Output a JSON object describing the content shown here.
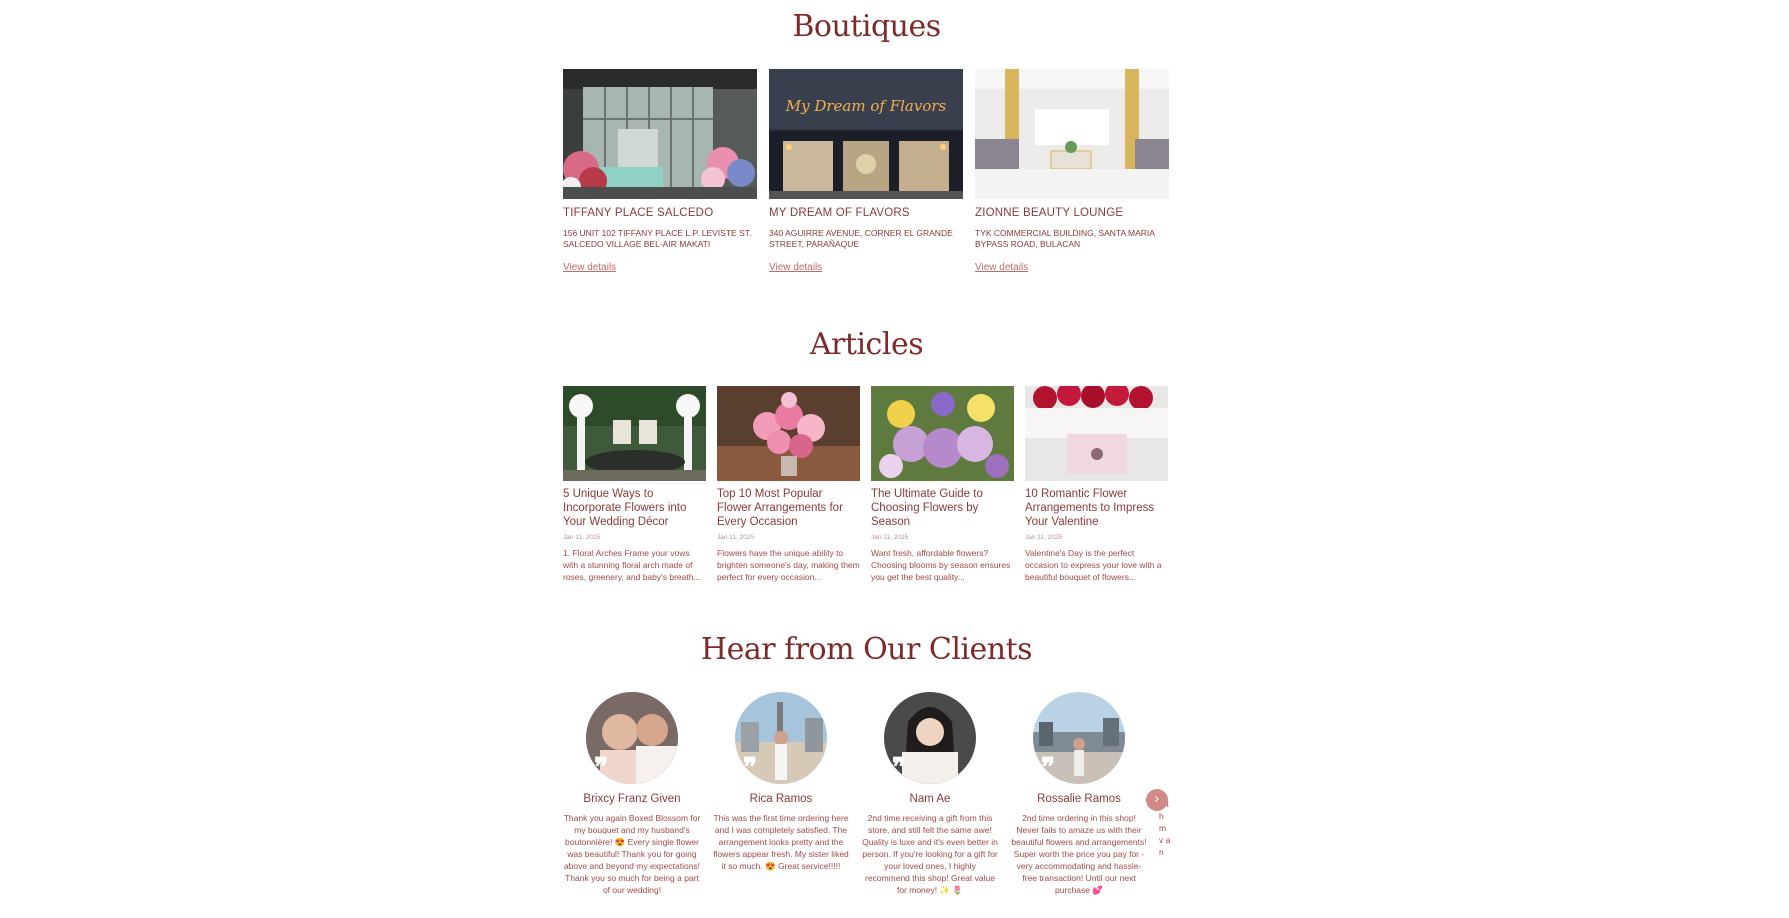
{
  "boutiques": {
    "title": "Boutiques",
    "items": [
      {
        "name": "TIFFANY PLACE SALCEDO",
        "address": "156 UNIT 102 TIFFANY PLACE L.P. LEVISTE ST. SALCEDO VILLAGE BEL-AIR MAKATI",
        "link": "View details"
      },
      {
        "name": "MY DREAM OF FLAVORS",
        "address": "340 AGUIRRE AVENUE, CORNER EL GRANDE STREET, PARAÑAQUE",
        "link": "View details",
        "sign": "My Dream of Flavors"
      },
      {
        "name": "ZIONNE BEAUTY LOUNGE",
        "address": "TYK COMMERCIAL BUILDING, SANTA MARIA BYPASS ROAD, BULACAN",
        "link": "View details"
      }
    ]
  },
  "articles": {
    "title": "Articles",
    "items": [
      {
        "title": "5 Unique Ways to Incorporate Flowers into Your Wedding Décor",
        "date": "Jan 11, 2025",
        "excerpt": "1. Floral Arches Frame your vows with a stunning floral arch made of roses, greenery, and baby's breath..."
      },
      {
        "title": "Top 10 Most Popular Flower Arrangements for Every Occasion",
        "date": "Jan 11, 2025",
        "excerpt": "Flowers have the unique ability to brighten someone's day, making them perfect for every occasion..."
      },
      {
        "title": "The Ultimate Guide to Choosing Flowers by Season",
        "date": "Jan 11, 2025",
        "excerpt": "Want fresh, affordable flowers? Choosing blooms by season ensures you get the best quality..."
      },
      {
        "title": "10 Romantic Flower Arrangements to Impress Your Valentine",
        "date": "Jan 11, 2025",
        "excerpt": "Valentine's Day is the perfect occasion to express your love with a beautiful bouquet of flowers..."
      }
    ]
  },
  "testimonials": {
    "title": "Hear from Our Clients",
    "quote_glyph": "❞",
    "next_glyph": "›",
    "partial_text": "T th m v an",
    "items": [
      {
        "name": "Brixcy Franz Given",
        "text": "Thank you again Boxed Blossom for my bouquet and my husband's boutonnière! 😍 Every single flower was beautiful! Thank you for going above and beyond my expectations! Thank you so much for being a part of our wedding!"
      },
      {
        "name": "Rica Ramos",
        "text": "This was the first time ordering here and I was completely satisfied. The arrangement looks pretty and the flowers appear fresh. My sister liked it so much. 😍 Great service!!!!!"
      },
      {
        "name": "Nam Ae",
        "text": "2nd time receiving a gift from this store, and still felt the same awe! Quality is luxe and it's even better in person. If you're looking for a gift for your loved ones, I highly recommend this shop! Great value for money! ✨ 🌷"
      },
      {
        "name": "Rossalie Ramos",
        "text": "2nd time ordering in this shop! Never fails to amaze us with their beautiful flowers and arrangements! Super worth the price you pay for - very accommodating and hassle-free transaction! Until our next purchase 💕"
      }
    ]
  },
  "colors": {
    "title": "#7d2a2a",
    "text": "#8a3a3a",
    "link": "#c06a6a",
    "next_button": "#d08a8a"
  }
}
